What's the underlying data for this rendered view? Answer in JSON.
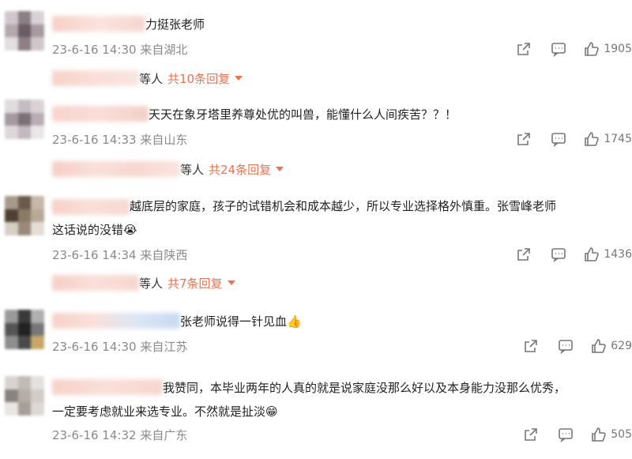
{
  "comments": [
    {
      "text_lines": [
        "力挺张老师"
      ],
      "date": "23-6-16 14:30",
      "location": "来自湖北",
      "likes": "1905",
      "replies": {
        "etc": "等人",
        "more": "共10条回复"
      }
    },
    {
      "text_lines": [
        "天天在象牙塔里养尊处优的叫兽，能懂什么人间疾苦？？！"
      ],
      "date": "23-6-16 14:33",
      "location": "来自山东",
      "likes": "1745",
      "replies": {
        "etc": "等人",
        "more": "共24条回复"
      }
    },
    {
      "text_lines": [
        "越底层的家庭，孩子的试错机会和成本越少，所以专业选择格外慎重。张雪峰老师",
        "这话说的没错😭"
      ],
      "date": "23-6-16 14:34",
      "location": "来自陕西",
      "likes": "1436",
      "replies": {
        "etc": "等人",
        "more": "共7条回复"
      }
    },
    {
      "text_lines": [
        "张老师说得一针见血👍"
      ],
      "date": "23-6-16 14:30",
      "location": "来自江苏",
      "likes": "629",
      "replies": null
    },
    {
      "text_lines": [
        "我赞同，本毕业两年的人真的就是说家庭没那么好以及本身能力没那么优秀，",
        "一定要考虑就业来选专业。不然就是扯淡😁"
      ],
      "date": "23-6-16 14:32",
      "location": "来自广东",
      "likes": "505",
      "replies": null
    }
  ],
  "icons": {
    "share": "share-icon",
    "comment": "comment-icon",
    "like": "like-icon"
  },
  "colors": {
    "reply_link": "#eb7350",
    "meta": "#8a8a8a"
  }
}
